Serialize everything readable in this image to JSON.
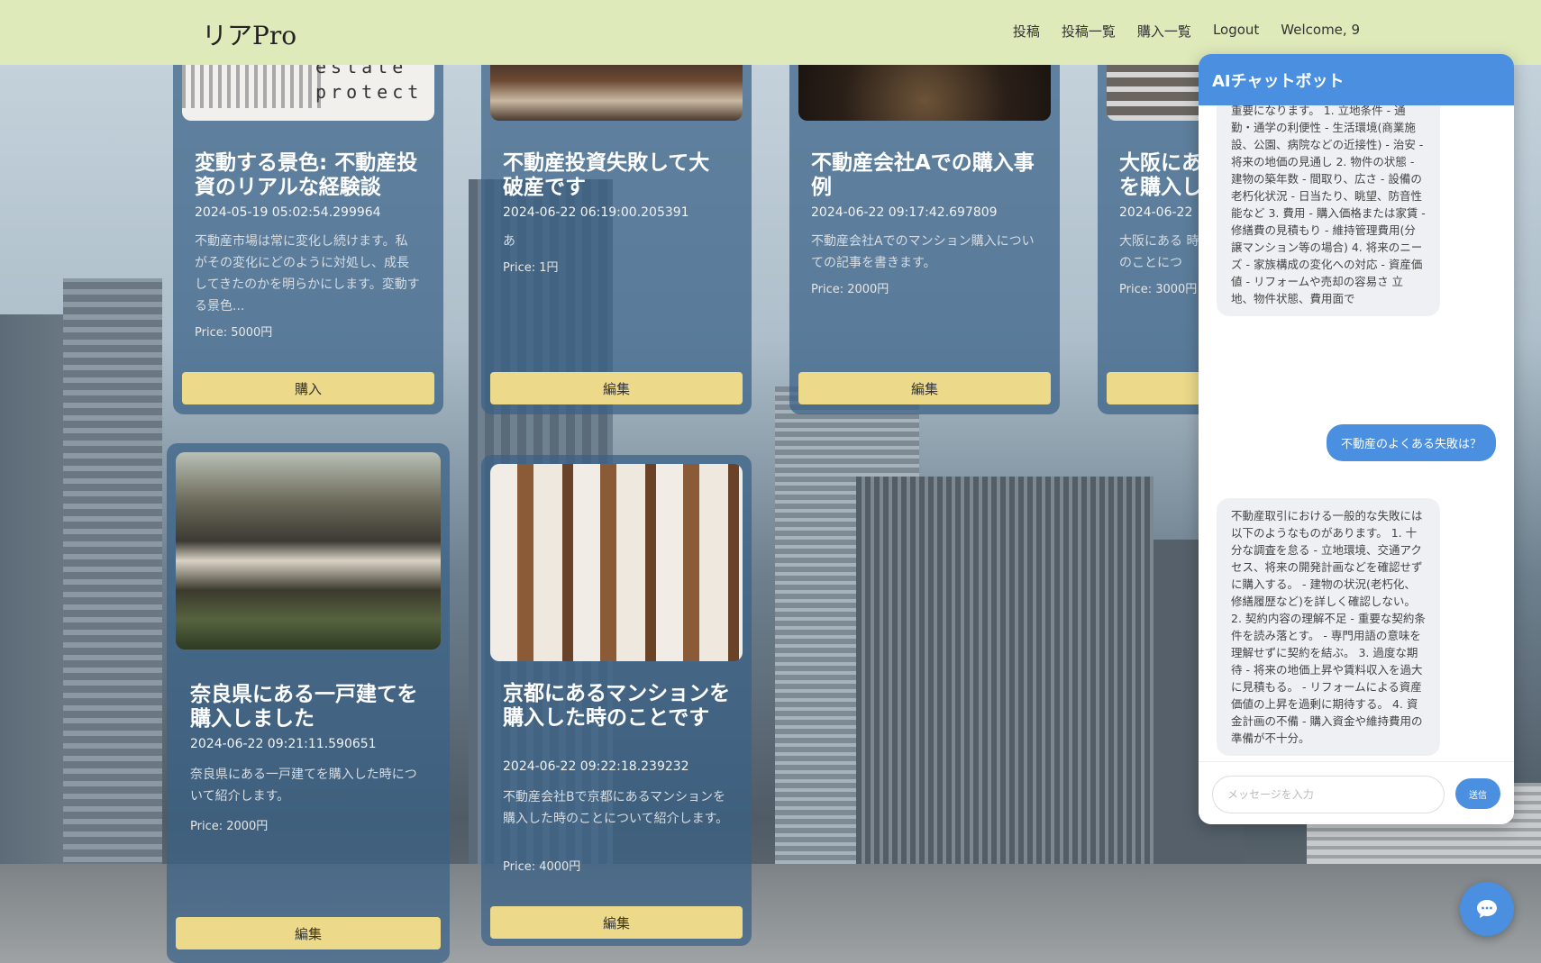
{
  "navbar": {
    "logo": "リアPro",
    "links": [
      "投稿",
      "投稿一覧",
      "購入一覧",
      "Logout",
      "Welcome, 9"
    ]
  },
  "cards": [
    {
      "image": "estate-protect-logo",
      "image_text": "estate protect",
      "title": "変動する景色: 不動産投資のリアルな経験談",
      "date": "2024-05-19 05:02:54.299964",
      "description": "不動産市場は常に変化し続けます。私がその変化にどのように対処し、成長してきたのかを明らかにします。変動する景色...",
      "price": "Price: 5000円",
      "button": "購入"
    },
    {
      "image": "miniature-houses",
      "title": "不動産投資失敗して大破産です",
      "date": "2024-06-22 06:19:00.205391",
      "description": "あ",
      "price": "Price: 1円",
      "button": "編集"
    },
    {
      "image": "camera-lens",
      "title": "不動産会社Aでの購入事例",
      "date": "2024-06-22 09:17:42.697809",
      "description": "不動産会社Aでのマンション購入についての記事を書きます。",
      "price": "Price: 2000円",
      "button": "編集"
    },
    {
      "image": "building-facade",
      "title": "大阪にあ を購入し",
      "date": "2024-06-22",
      "description": "大阪にある 時のことにつ",
      "price": "Price: 3000円",
      "button": ""
    },
    {
      "image": "japanese-house",
      "title": "奈良県にある一戸建てを購入しました",
      "date": "2024-06-22 09:21:11.590651",
      "description": "奈良県にある一戸建てを購入した時について紹介します。",
      "price": "Price: 2000円",
      "button": "編集"
    },
    {
      "image": "mansion-balconies",
      "title": "京都にあるマンションを購入した時のことです",
      "date": "2024-06-22 09:22:18.239232",
      "description": "不動産会社Bで京都にあるマンションを購入した時のことについて紹介します。",
      "price": "Price: 4000円",
      "button": "編集"
    }
  ],
  "chat": {
    "title": "AIチャットボット",
    "messages": [
      {
        "role": "bot",
        "text": "重要になります。 1. 立地条件 - 通勤・通学の利便性 - 生活環境(商業施設、公園、病院などの近接性) - 治安 - 将来の地価の見通し 2. 物件の状態 - 建物の築年数 - 間取り、広さ - 設備の老朽化状況 - 日当たり、眺望、防音性能など 3. 費用 - 購入価格または家賃 - 修繕費の見積もり - 維持管理費用(分譲マンション等の場合) 4. 将来のニーズ - 家族構成の変化への対応 - 資産価値 - リフォームや売却の容易さ 立地、物件状態、費用面で"
      },
      {
        "role": "user",
        "text": "不動産のよくある失敗は？"
      },
      {
        "role": "bot",
        "text": "不動産取引における一般的な失敗には以下のようなものがあります。 1. 十分な調査を怠る - 立地環境、交通アクセス、将来の開発計画などを確認せずに購入する。 - 建物の状況(老朽化、修繕履歴など)を詳しく確認しない。 2. 契約内容の理解不足 - 重要な契約条件を読み落とす。 - 専門用語の意味を理解せずに契約を結ぶ。 3. 過度な期待 - 将来の地価上昇や賃料収入を過大に見積もる。 - リフォームによる資産価値の上昇を過剰に期待する。 4. 資金計画の不備 - 購入資金や維持費用の準備が不十分。"
      }
    ],
    "input_placeholder": "メッセージを入力",
    "send_label": "送信"
  },
  "icons": {
    "fab": "chat-bubble-icon"
  },
  "colors": {
    "navbar": "#dfeaba",
    "card": "#396186",
    "button": "#ecd98a",
    "chat_accent": "#4a8fe0"
  }
}
